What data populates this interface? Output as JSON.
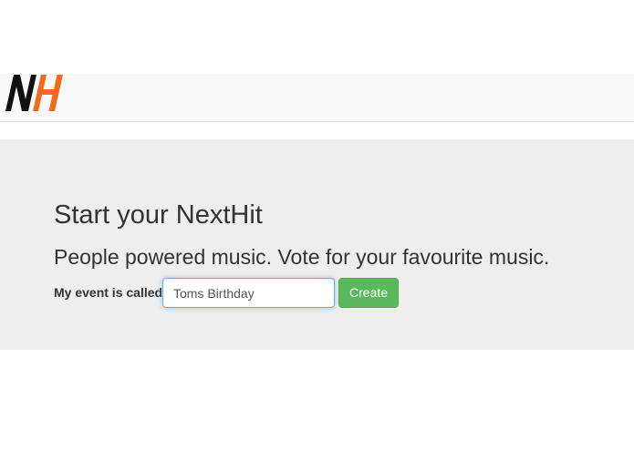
{
  "navbar": {
    "logo": {
      "text": "NH",
      "icon": "nexthit-logo",
      "colors": {
        "n": "#111111",
        "h": "#f26b1d"
      }
    }
  },
  "hero": {
    "title": "Start your NextHit",
    "tagline": "People powered music. Vote for your favourite music.",
    "form": {
      "label": "My event is called",
      "input_value": "Toms Birthday",
      "button_label": "Create"
    }
  },
  "colors": {
    "navbar_bg": "#f8f8f8",
    "hero_bg": "#eeeeee",
    "button_green": "#5cb85c",
    "input_focus": "#66afe9"
  }
}
